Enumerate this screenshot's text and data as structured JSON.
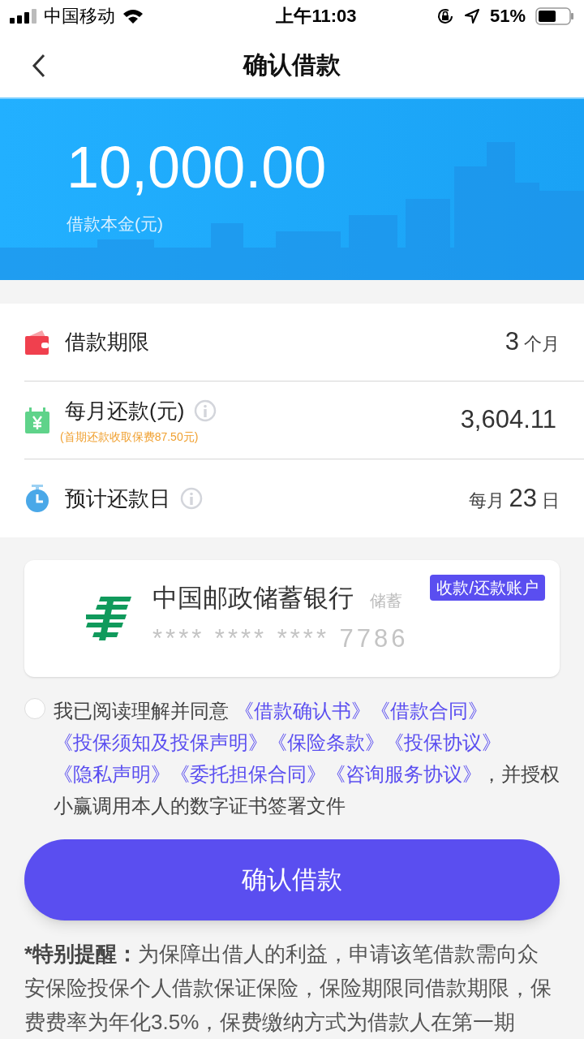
{
  "status_bar": {
    "carrier": "中国移动",
    "time": "上午11:03",
    "battery": "51%"
  },
  "nav": {
    "title": "确认借款"
  },
  "banner": {
    "amount": "10,000.00",
    "label": "借款本金(元)"
  },
  "rows": [
    {
      "kind": "wallet",
      "label": "借款期限",
      "info": false,
      "parts": [
        {
          "kind": "number",
          "text": "3"
        },
        {
          "kind": "unit",
          "text": "个月"
        }
      ]
    },
    {
      "kind": "calendar",
      "label": "每月还款(元)",
      "info": true,
      "note": "(首期还款收取保费87.50元)",
      "parts": [
        {
          "kind": "number",
          "text": "3,604.11"
        }
      ]
    },
    {
      "kind": "timer",
      "label": "预计还款日",
      "info": true,
      "parts": [
        {
          "kind": "unit",
          "text": "每月"
        },
        {
          "kind": "number",
          "text": "23"
        },
        {
          "kind": "unit",
          "text": "日"
        }
      ]
    }
  ],
  "card": {
    "bank": "中国邮政储蓄银行",
    "card_type": "储蓄",
    "number": "**** **** **** 7786",
    "badge": "收款/还款账户"
  },
  "agreement": {
    "checked": false,
    "prefix": "我已阅读理解并同意 ",
    "links": [
      "《借款确认书》",
      "《借款合同》",
      "《投保须知及投保声明》",
      "《保险条款》",
      "《投保协议》",
      "《隐私声明》",
      "《委托担保合同》",
      "《咨询服务协议》"
    ],
    "suffix": "，并授权小赢调用本人的数字证书签署文件"
  },
  "confirm_button": "确认借款",
  "notice": {
    "title": "*特别提醒：",
    "text": "为保障出借人的利益，申请该笔借款需向众安保险投保个人借款保证保险，保险期限同借款期限，保费费率为年化3.5%，保费缴纳方式为借款人在第一期"
  }
}
